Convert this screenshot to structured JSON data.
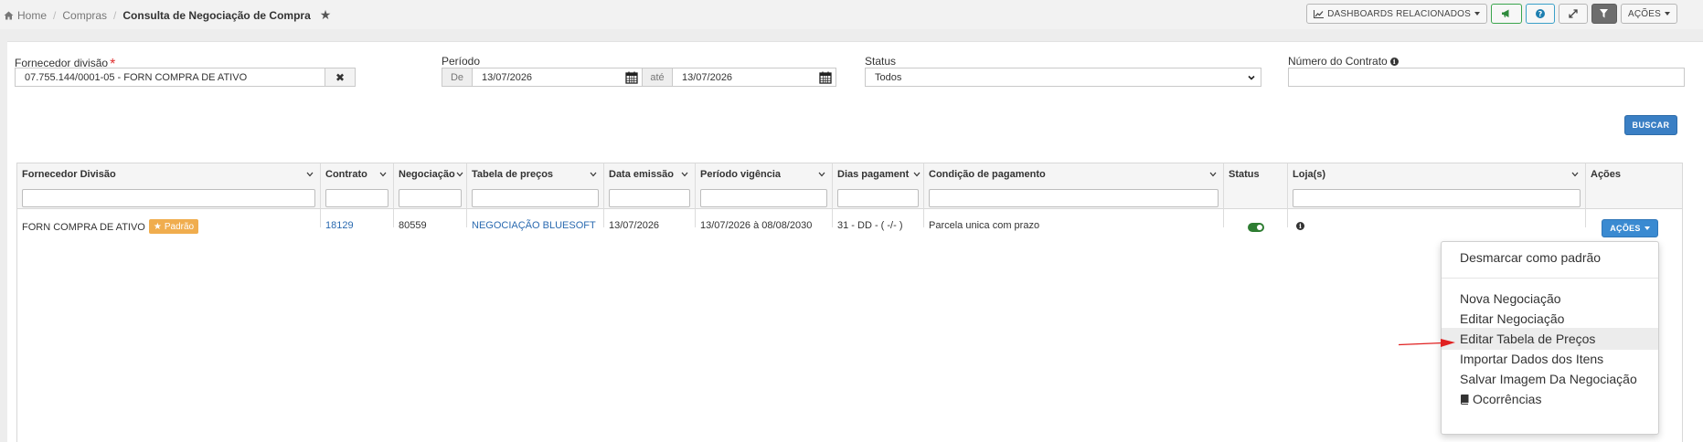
{
  "breadcrumb": {
    "home": "Home",
    "section": "Compras",
    "current": "Consulta de Negociação de Compra"
  },
  "toolbar": {
    "dashboards": "DASHBOARDS RELACIONADOS",
    "acoes": "AÇÕES"
  },
  "filters": {
    "fornecedor_label": "Fornecedor divisão",
    "fornecedor_value": "07.755.144/0001-05 - FORN COMPRA DE ATIVO",
    "periodo_label": "Período",
    "de": "De",
    "ate": "até",
    "periodo_inicio": "13/07/2026",
    "periodo_fim": "13/07/2026",
    "status_label": "Status",
    "status_value": "Todos",
    "contrato_label": "Número do Contrato",
    "contrato_value": "",
    "buscar": "BUSCAR"
  },
  "table": {
    "columns": [
      "Fornecedor Divisão",
      "Contrato",
      "Negociação",
      "Tabela de preços",
      "Data emissão",
      "Período vigência",
      "Dias pagament",
      "Condição de pagamento",
      "Status",
      "Loja(s)",
      "Ações"
    ],
    "row": {
      "fornecedor": "FORN COMPRA DE ATIVO",
      "badge": "Padrão",
      "contrato": "18129",
      "negociacao": "80559",
      "tabela": "NEGOCIAÇÃO BLUESOFT",
      "data_emissao": "13/07/2026",
      "periodo": "13/07/2026 à 08/08/2030",
      "dias": "31 - DD - ( -/- )",
      "condicao": "Parcela unica com prazo",
      "status_on": true,
      "acoes": "AÇÕES"
    }
  },
  "menu": {
    "items": [
      "Desmarcar como padrão",
      "Nova Negociação",
      "Editar Negociação",
      "Editar Tabela de Preços",
      "Importar Dados dos Itens",
      "Salvar Imagem Da Negociação",
      "Ocorrências"
    ],
    "highlighted_index": 3
  },
  "colors": {
    "primary": "#3a8ad1",
    "badge": "#f0ad4e",
    "toggle": "#2e7d32",
    "arrow": "#e02020"
  }
}
